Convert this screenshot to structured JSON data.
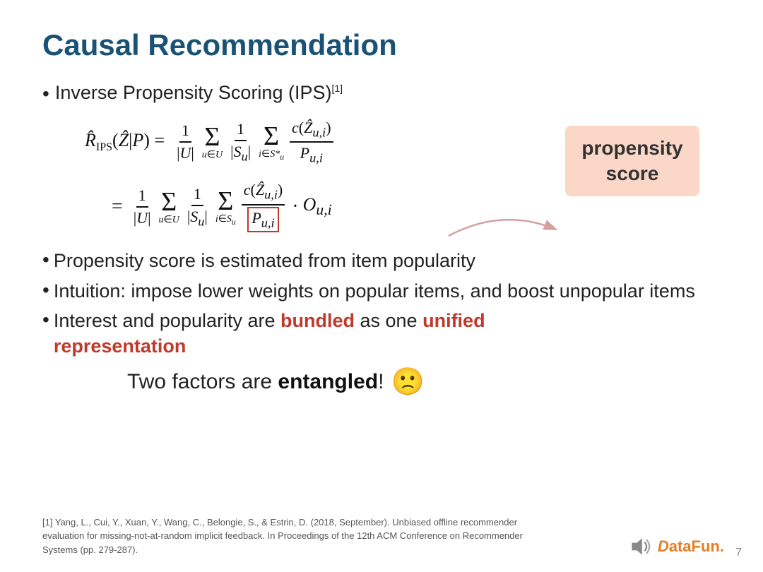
{
  "title": "Causal Recommendation",
  "bullet1": {
    "label": "Inverse Propensity Scoring (IPS)",
    "sup": "[1]"
  },
  "formula": {
    "line1_lhs": "R̂IPS(Ẑ|P) =",
    "line2_lhs": "="
  },
  "propensity_callout": {
    "text": "propensity\nscore"
  },
  "bullets_lower": [
    "Propensity score is estimated from item popularity",
    "Intuition: impose lower weights on popular items, and boost unpopular items",
    "Interest and popularity are bundled as one unified representation"
  ],
  "bundled_word": "bundled",
  "unified_text": "unified",
  "representation_text": "representation",
  "entangled_line": {
    "prefix": "Two factors are ",
    "bold": "entangled",
    "suffix": "!"
  },
  "footnote": "[1] Yang, L., Cui, Y., Xuan, Y., Wang, C., Belongie, S., & Estrin, D. (2018, September). Unbiased offline recommender evaluation for missing-not-at-random implicit feedback. In Proceedings of the 12th ACM Conference on Recommender Systems (pp. 279-287).",
  "logo": {
    "text": "DataFun."
  },
  "slide_number": "7"
}
